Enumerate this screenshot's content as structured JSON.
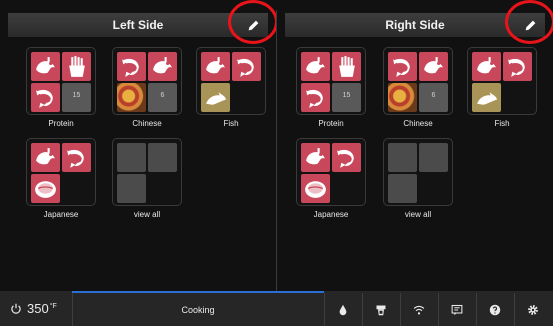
{
  "left_panel": {
    "title": "Left Side",
    "tiles": [
      {
        "label": "Protein",
        "count": "15"
      },
      {
        "label": "Chinese",
        "count": "6"
      },
      {
        "label": "Fish"
      },
      {
        "label": "Japanese"
      },
      {
        "label": "view all"
      }
    ]
  },
  "right_panel": {
    "title": "Right Side",
    "tiles": [
      {
        "label": "Protein",
        "count": "15"
      },
      {
        "label": "Chinese",
        "count": "6"
      },
      {
        "label": "Fish"
      },
      {
        "label": "Japanese"
      },
      {
        "label": "view all"
      }
    ]
  },
  "statusbar": {
    "temperature": "350",
    "temperature_unit": "°F",
    "mode": "Cooking",
    "icons": [
      "water-drop-icon",
      "appliance-icon",
      "wifi-icon",
      "chat-icon",
      "help-icon",
      "gear-icon"
    ]
  },
  "colors": {
    "tile_pink": "#c8475a",
    "tile_gray": "#595959",
    "tile_tan": "#a89457",
    "accent_blue": "#2a6fd6",
    "annotation_red": "#e8141a"
  }
}
